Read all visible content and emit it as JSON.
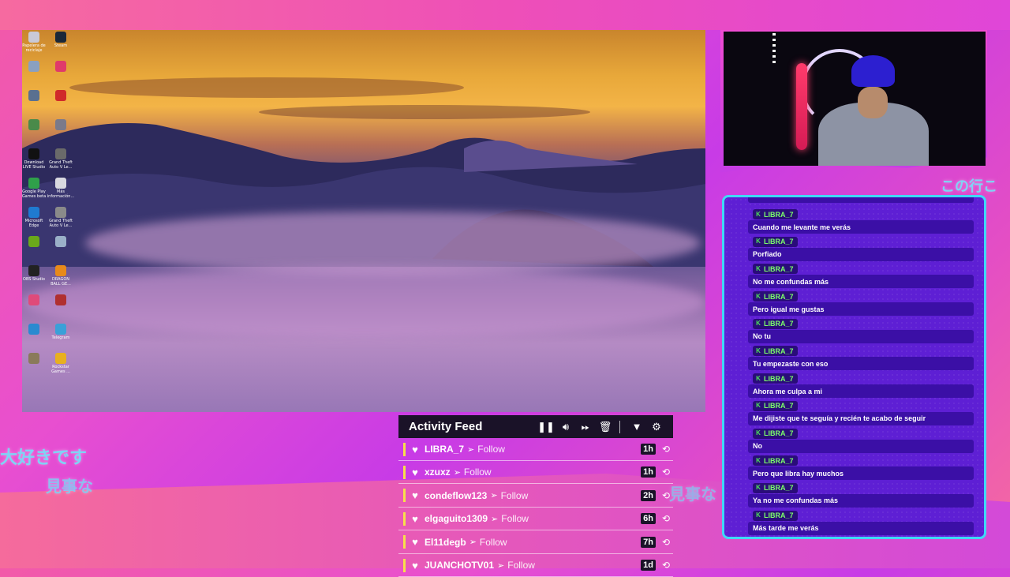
{
  "background_text": [
    "大好きです",
    "見事な",
    "見事な",
    "この行こ"
  ],
  "desktop_icons": [
    {
      "label": "Papelera de reciclaje",
      "icon": "recycle-bin-icon",
      "color": "#c9c9d6"
    },
    {
      "label": "Steam",
      "icon": "steam-icon",
      "color": "#1b2838"
    },
    {
      "label": "",
      "icon": "app-icon",
      "color": "#8aa0c0"
    },
    {
      "label": "",
      "icon": "app-icon",
      "color": "#e03a6a"
    },
    {
      "label": "",
      "icon": "app-icon",
      "color": "#5a7090"
    },
    {
      "label": "",
      "icon": "app-icon",
      "color": "#d02a2a"
    },
    {
      "label": "",
      "icon": "app-icon",
      "color": "#4a8a4a"
    },
    {
      "label": "",
      "icon": "app-icon",
      "color": "#7a7a8a"
    },
    {
      "label": "Download LIVE Studio",
      "icon": "tiktok-icon",
      "color": "#111111"
    },
    {
      "label": "Grand Theft Auto V Le...",
      "icon": "gta-icon",
      "color": "#6a6a6a"
    },
    {
      "label": "Google Play Games beta",
      "icon": "play-games-icon",
      "color": "#2fa04a"
    },
    {
      "label": "Más información...",
      "icon": "info-icon",
      "color": "#d8d8e0"
    },
    {
      "label": "Microsoft Edge",
      "icon": "edge-icon",
      "color": "#1f7ad0"
    },
    {
      "label": "Grand Theft Auto V Le...",
      "icon": "gta-icon",
      "color": "#8a8a8a"
    },
    {
      "label": "",
      "icon": "nvidia-icon",
      "color": "#6aa81a"
    },
    {
      "label": "",
      "icon": "app-icon",
      "color": "#9ab0c8"
    },
    {
      "label": "OBS Studio",
      "icon": "obs-icon",
      "color": "#222222"
    },
    {
      "label": "DRAGON BALL GE...",
      "icon": "dragonball-icon",
      "color": "#e88a1a"
    },
    {
      "label": "",
      "icon": "app-icon",
      "color": "#e04a7a"
    },
    {
      "label": "",
      "icon": "app-icon",
      "color": "#b03030"
    },
    {
      "label": "",
      "icon": "edge-icon",
      "color": "#2a8ad0"
    },
    {
      "label": "Telegram",
      "icon": "telegram-icon",
      "color": "#3aa0d8"
    },
    {
      "label": "",
      "icon": "app-icon",
      "color": "#8a7a5a"
    },
    {
      "label": "Rockstar Games ...",
      "icon": "rockstar-icon",
      "color": "#e8b020"
    }
  ],
  "webcam": {
    "label": "webcam"
  },
  "chat": {
    "messages": [
      {
        "user": "LIBRA_7",
        "text": "Cuando me levante me verás"
      },
      {
        "user": "LIBRA_7",
        "text": "Porfiado"
      },
      {
        "user": "LIBRA_7",
        "text": "No me confundas más"
      },
      {
        "user": "LIBRA_7",
        "text": "Pero igual me gustas"
      },
      {
        "user": "LIBRA_7",
        "text": "No tu"
      },
      {
        "user": "LIBRA_7",
        "text": "Tu empezaste con eso"
      },
      {
        "user": "LIBRA_7",
        "text": "Ahora me culpa a mi"
      },
      {
        "user": "LIBRA_7",
        "text": "Me dijiste que te seguía y recién te acabo de seguir"
      },
      {
        "user": "LIBRA_7",
        "text": "No"
      },
      {
        "user": "LIBRA_7",
        "text": "Pero que libra hay muchos"
      },
      {
        "user": "LIBRA_7",
        "text": "Ya no me confundas más"
      },
      {
        "user": "LIBRA_7",
        "text": "Más tarde me verás"
      }
    ],
    "accent": "#3fd9f6",
    "name_color": "#7cff6a"
  },
  "activity_feed": {
    "title": "Activity Feed",
    "controls": [
      "pause-icon",
      "volume-icon",
      "skip-icon",
      "trash-icon",
      "filter-icon",
      "gear-icon"
    ],
    "rows": [
      {
        "user": "LIBRA_7",
        "action": "Follow",
        "age": "1h"
      },
      {
        "user": "xzuxz",
        "action": "Follow",
        "age": "1h"
      },
      {
        "user": "condeflow123",
        "action": "Follow",
        "age": "2h"
      },
      {
        "user": "elgaguito1309",
        "action": "Follow",
        "age": "6h"
      },
      {
        "user": "El11degb",
        "action": "Follow",
        "age": "7h"
      },
      {
        "user": "JUANCHOTV01",
        "action": "Follow",
        "age": "1d"
      }
    ]
  }
}
